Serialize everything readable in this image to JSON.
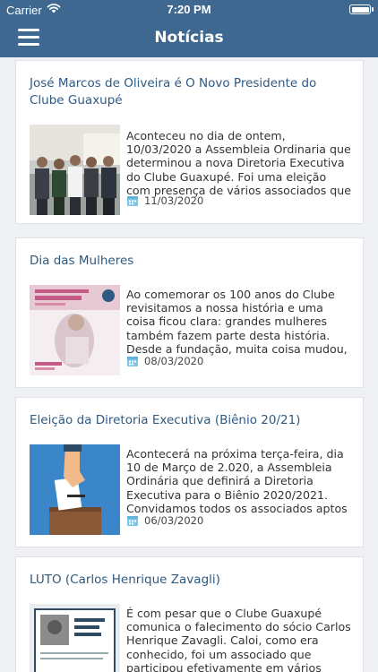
{
  "status_bar": {
    "carrier": "Carrier",
    "time": "7:20 PM"
  },
  "header": {
    "title": "Notícias",
    "menu_icon": "hamburger-menu-icon"
  },
  "colors": {
    "header": "#3e6890",
    "title_text": "#2f5a82",
    "calendar": "#7ec6e8"
  },
  "news": [
    {
      "title": "José Marcos de Oliveira é O Novo Presidente do Clube Guaxupé",
      "excerpt": "Aconteceu no dia de ontem, 10/03/2020 a Assembleia Ordinaria que determinou a nova Diretoria Executiva do Clube Guaxupé.  Foi uma eleição com presença de vários associados que através do",
      "date": "11/03/2020"
    },
    {
      "title": "Dia das Mulheres",
      "excerpt": "Ao comemorar os 100 anos do Clube revisitamos a nossa história e uma coisa ficou clara: grandes mulheres também fazem parte desta história. Desde a fundação, muita coisa mudou, as",
      "date": "08/03/2020"
    },
    {
      "title": "Eleição da Diretoria Executiva (Biênio 20/21)",
      "excerpt": "Acontecerá na próxima terça-feira, dia 10 de Março de 2.020, a Assembleia Ordinária que definirá a Diretoria Executiva para o Biênio 2020/2021. Convidamos todos os associados aptos",
      "date": "06/03/2020"
    },
    {
      "title": "LUTO (Carlos Henrique Zavagli)",
      "excerpt": "É com pesar que o Clube Guaxupé comunica o falecimento do sócio Carlos Henrique Zavagli. Caloi, como era conhecido, foi um associado que participou efetivamente em vários fatos",
      "date": ""
    }
  ]
}
